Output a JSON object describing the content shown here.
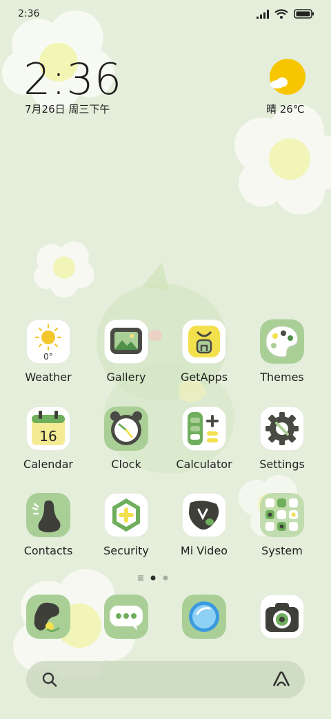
{
  "status": {
    "time": "2:36"
  },
  "clock": {
    "time": "2:36",
    "date": "7月26日 周三下午"
  },
  "weather": {
    "text": "晴 26℃"
  },
  "colors": {
    "wallpaper": "#e4eedb",
    "icon_green": "#a9cf97",
    "sun_yellow": "#f7c600"
  },
  "apps": [
    {
      "label": "Weather",
      "icon": "weather-icon",
      "temp": "0°"
    },
    {
      "label": "Gallery",
      "icon": "gallery-icon"
    },
    {
      "label": "GetApps",
      "icon": "getapps-icon"
    },
    {
      "label": "Themes",
      "icon": "themes-icon"
    },
    {
      "label": "Calendar",
      "icon": "calendar-icon",
      "day": "16"
    },
    {
      "label": "Clock",
      "icon": "clock-icon"
    },
    {
      "label": "Calculator",
      "icon": "calculator-icon"
    },
    {
      "label": "Settings",
      "icon": "settings-icon"
    },
    {
      "label": "Contacts",
      "icon": "contacts-icon"
    },
    {
      "label": "Security",
      "icon": "security-icon"
    },
    {
      "label": "Mi Video",
      "icon": "mi-video-icon"
    },
    {
      "label": "System",
      "icon": "system-folder-icon"
    }
  ],
  "dock": [
    {
      "icon": "phone-icon"
    },
    {
      "icon": "messages-icon"
    },
    {
      "icon": "browser-icon"
    },
    {
      "icon": "camera-icon"
    }
  ],
  "search": {
    "left_icon": "search-icon",
    "right_icon": "assistant-icon"
  },
  "pages": {
    "count": 2,
    "current": 1
  }
}
